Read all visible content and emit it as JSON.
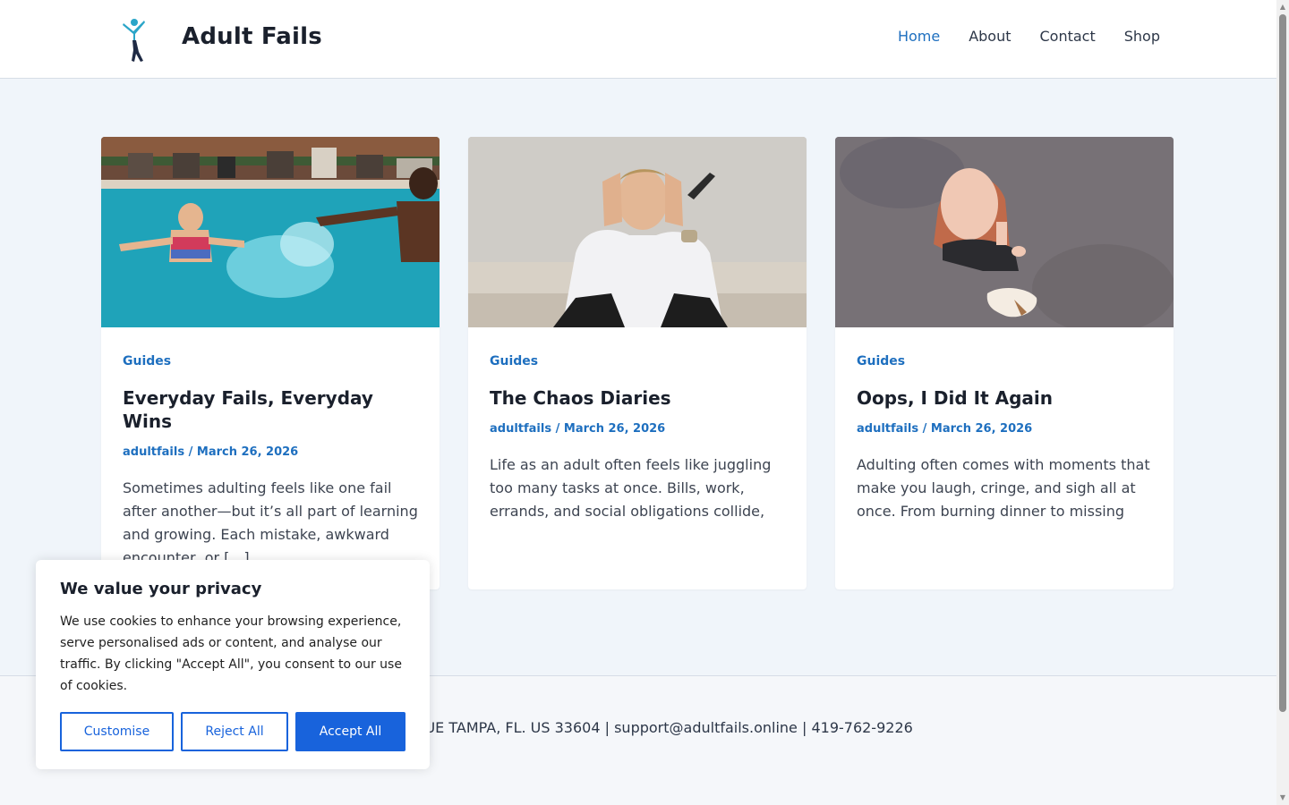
{
  "header": {
    "site_title": "Adult Fails",
    "nav": [
      {
        "label": "Home",
        "active": true
      },
      {
        "label": "About",
        "active": false
      },
      {
        "label": "Contact",
        "active": false
      },
      {
        "label": "Shop",
        "active": false
      }
    ]
  },
  "cards": [
    {
      "image": "pool-splash-photo",
      "category": "Guides",
      "title": "Everyday Fails, Everyday Wins",
      "meta": "adultfails / March 26, 2026",
      "excerpt": "Sometimes adulting feels like one fail after another—but it’s all part of learning and growing. Each mistake, awkward encounter, or […]"
    },
    {
      "image": "stressed-man-photo",
      "category": "Guides",
      "title": "The Chaos Diaries",
      "meta": "adultfails / March 26, 2026",
      "excerpt": "Life as an adult often feels like juggling too many tasks at once. Bills, work, errands, and social obligations collide,"
    },
    {
      "image": "dropped-ice-cream-photo",
      "category": "Guides",
      "title": "Oops, I Did It Again",
      "meta": "adultfails / March 26, 2026",
      "excerpt": "Adulting often comes with moments that make you laugh, cringe, and sigh all at once. From burning dinner to missing"
    }
  ],
  "footer": {
    "text": "EE AVENUE TAMPA, FL. US 33604 | support@adultfails.online | 419-762-9226"
  },
  "cookie_banner": {
    "title": "We value your privacy",
    "body": "We use cookies to enhance your browsing experience, serve personalised ads or content, and analyse our traffic. By clicking \"Accept All\", you consent to our use of cookies.",
    "customise_label": "Customise",
    "reject_label": "Reject All",
    "accept_label": "Accept All"
  },
  "colors": {
    "accent": "#1e6fbf",
    "cookie_button": "#1863dc",
    "page_background": "#f0f5fa"
  }
}
